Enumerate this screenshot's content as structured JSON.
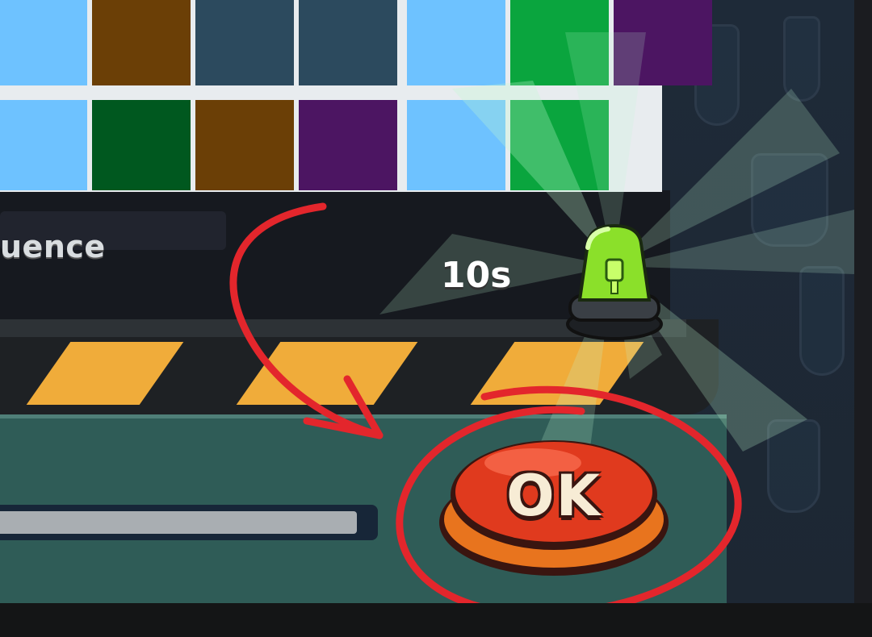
{
  "sequence_label": "uence",
  "timer": {
    "text": "10s",
    "beacon_color": "#8be02a"
  },
  "ok_button": {
    "label": "OK",
    "color": "#e03a1e",
    "base_color": "#e8741e"
  },
  "progress": {
    "fraction": 0.97
  },
  "grid": {
    "rows": [
      [
        "#6ec2ff",
        "#6b3f06",
        "#2c4a5e",
        "#2c4a5e",
        "#6ec2ff",
        "#0aa53e",
        "#4c1562"
      ],
      [
        "#6ec2ff",
        "#00581f",
        "#6b3f06",
        "#4c1562",
        "#6ec2ff",
        "#0aa53e"
      ]
    ]
  },
  "colors": {
    "annotation": "#e3262c",
    "stripe": "#f0ac3a",
    "panel": "#2f5c57"
  },
  "icons": {
    "beacon": "siren-icon",
    "annotation": "arrow-annotation"
  }
}
